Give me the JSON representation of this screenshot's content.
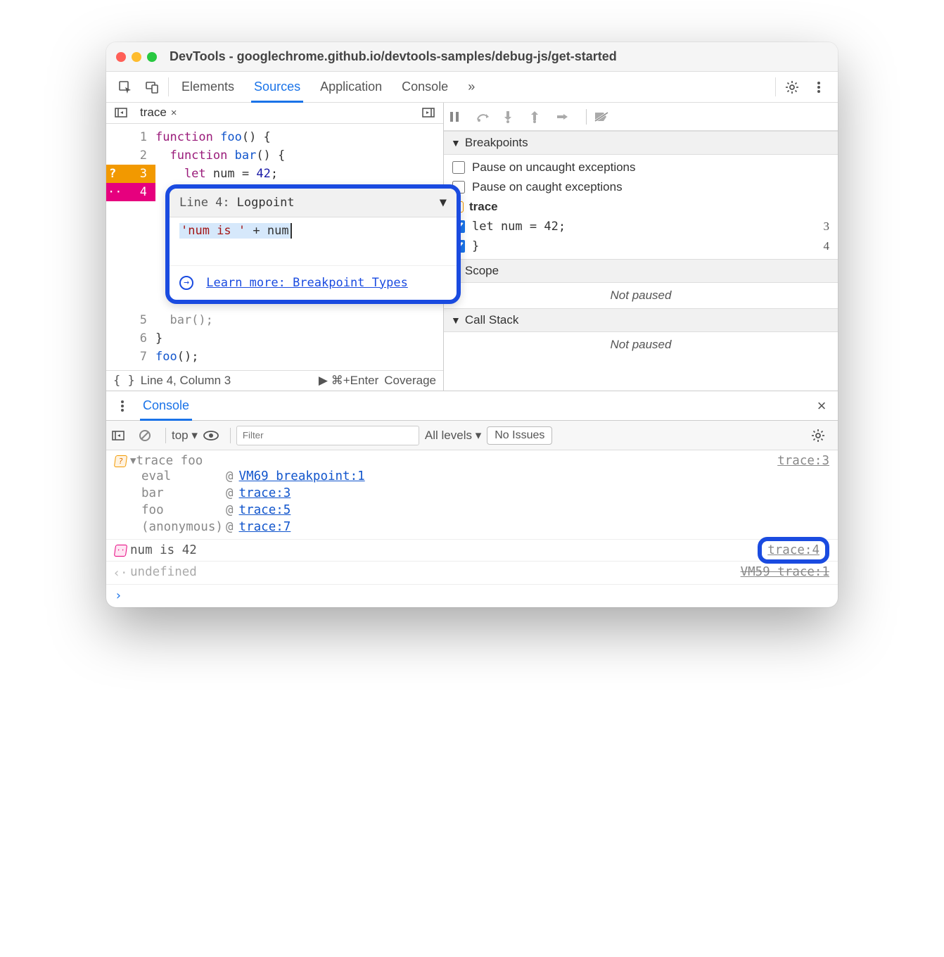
{
  "window": {
    "title": "DevTools - googlechrome.github.io/devtools-samples/debug-js/get-started"
  },
  "tabs": {
    "elements": "Elements",
    "sources": "Sources",
    "application": "Application",
    "console": "Console",
    "more": "»"
  },
  "file_tab": {
    "name": "trace",
    "close": "×"
  },
  "code": {
    "l1": {
      "n": "1",
      "t_kw": "function ",
      "t_name": "foo",
      "t_rest": "() {"
    },
    "l2": {
      "n": "2",
      "t_kw": "  function ",
      "t_name": "bar",
      "t_rest": "() {"
    },
    "l3": {
      "n": "3",
      "t_kw": "    let ",
      "t_id": "num",
      "t_eq": " = ",
      "t_num": "42",
      "t_sc": ";"
    },
    "l4": {
      "n": "4",
      "t": "  }"
    },
    "l5": {
      "n": "5",
      "t": "  bar();"
    },
    "l6": {
      "n": "6",
      "t": "}"
    },
    "l7": {
      "n": "7",
      "t": "foo();"
    }
  },
  "popup": {
    "line_label": "Line 4:",
    "type": "Logpoint",
    "expr_str": "'num is '",
    "expr_op": " + ",
    "expr_id": "num",
    "learn_more": "Learn more: Breakpoint Types"
  },
  "footer": {
    "pretty": "{ }",
    "pos": "Line 4, Column 3",
    "run": "▶ ⌘+Enter",
    "coverage": "Coverage"
  },
  "debug": {
    "breakpoints_header": "Breakpoints",
    "pause_uncaught": "Pause on uncaught exceptions",
    "pause_caught": "Pause on caught exceptions",
    "file": "trace",
    "bp1_code": "let num = 42;",
    "bp1_ln": "3",
    "bp2_code": "}",
    "bp2_ln": "4",
    "scope_header": "Scope",
    "not_paused": "Not paused",
    "callstack_header": "Call Stack"
  },
  "drawer": {
    "console": "Console"
  },
  "console_toolbar": {
    "context": "top ▾",
    "filter_placeholder": "Filter",
    "levels": "All levels ▾",
    "issues": "No Issues"
  },
  "console": {
    "trace_label": "trace foo",
    "trace_loc": "trace:3",
    "fn_eval": "eval",
    "loc_eval": "VM69 breakpoint:1",
    "fn_bar": "bar",
    "loc_bar": "trace:3",
    "fn_foo": "foo",
    "loc_foo": "trace:5",
    "fn_anon": "(anonymous)",
    "loc_anon": "trace:7",
    "at": "@",
    "log_msg": "num is 42",
    "log_loc": "trace:4",
    "undef": "undefined",
    "undef_loc": "VM59 trace:1",
    "prompt": "›"
  }
}
